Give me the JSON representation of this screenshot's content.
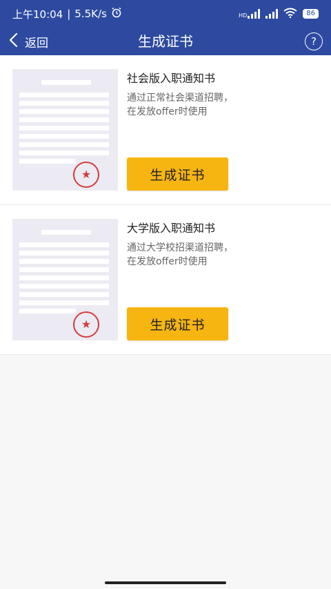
{
  "status_bar": {
    "time": "上午10:04",
    "separator": "|",
    "speed": "5.5K/s",
    "network_label": "HD",
    "battery": "86"
  },
  "nav": {
    "back_label": "返回",
    "title": "生成证书",
    "help_symbol": "?"
  },
  "cards": [
    {
      "title": "社会版入职通知书",
      "desc_line1": "通过正常社会渠道招聘，",
      "desc_line2": "在发放offer时使用",
      "button_label": "生成证书"
    },
    {
      "title": "大学版入职通知书",
      "desc_line1": "通过大学校招渠道招聘，",
      "desc_line2": "在发放offer时使用",
      "button_label": "生成证书"
    }
  ],
  "colors": {
    "header_bg": "#2d4aa0",
    "button_bg": "#f7b512",
    "stamp_red": "#d63a3a",
    "page_bg": "#f7f7f8"
  }
}
